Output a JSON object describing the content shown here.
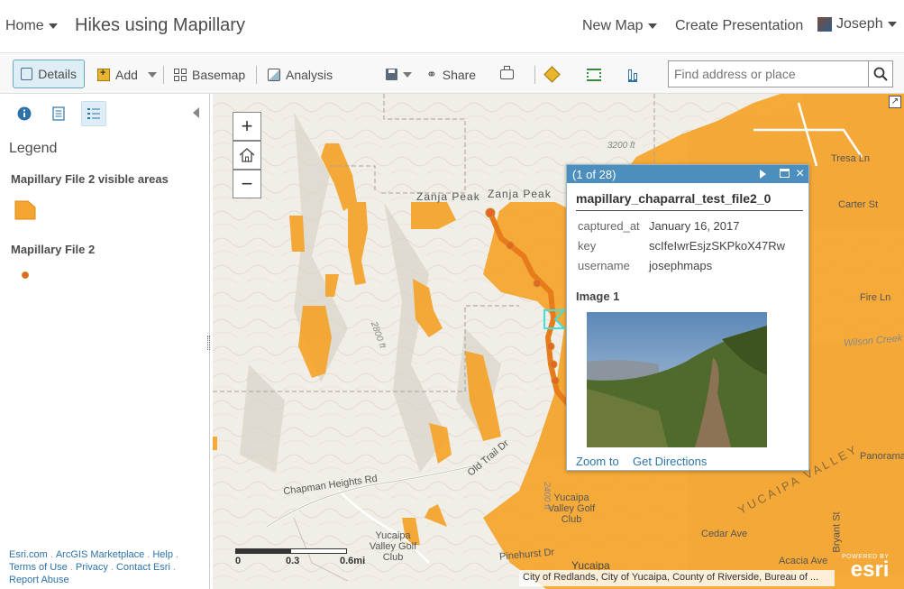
{
  "header": {
    "home_label": "Home",
    "title": "Hikes using Mapillary",
    "new_map_label": "New Map",
    "create_presentation_label": "Create Presentation",
    "user_name": "Joseph"
  },
  "toolbar": {
    "details_label": "Details",
    "add_label": "Add",
    "basemap_label": "Basemap",
    "analysis_label": "Analysis",
    "share_label": "Share",
    "search_placeholder": "Find address or place"
  },
  "sidebar": {
    "legend_title": "Legend",
    "layers": [
      {
        "title": "Mapillary File 2 visible areas"
      },
      {
        "title": "Mapillary File 2"
      }
    ],
    "footer_links": [
      "Esri.com",
      "ArcGIS Marketplace",
      "Help",
      "Terms of Use",
      "Privacy",
      "Contact Esri",
      "Report Abuse"
    ]
  },
  "map": {
    "labels": [
      "Zanja Peak",
      "Zanja Peak",
      "Tresa Ln",
      "Carter St",
      "Fire Ln",
      "Wilson Creek",
      "Chapman Heights Rd",
      "Old Trail Dr",
      "Yucaipa Valley Golf Club",
      "Yucaipa Valley Golf Club",
      "YUCAIPA VALLEY",
      "Cedar Ave",
      "Pinehurst Dr",
      "Yucaipa",
      "Acacia Ave",
      "Panorama",
      "Bryant St",
      "3200 ft",
      "2800 ft",
      "2400 ft"
    ],
    "scale_labels": [
      "0",
      "0.3",
      "0.6mi"
    ],
    "attribution": "City of Redlands, City of Yucaipa, County of Riverside, Bureau of ...",
    "esri_powered": "POWERED BY",
    "esri_logo": "esri"
  },
  "popup": {
    "counter": "(1 of 28)",
    "title": "mapillary_chaparral_test_file2_0",
    "fields": [
      {
        "key": "captured_at",
        "value": "January 16, 2017"
      },
      {
        "key": "key",
        "value": "scIfeIwrEsjzSKPkoX47Rw"
      },
      {
        "key": "username",
        "value": "josephmaps"
      }
    ],
    "image_label": "Image 1",
    "zoom_to_label": "Zoom to",
    "directions_label": "Get Directions"
  },
  "colors": {
    "accent": "#4c8ebd",
    "visible_area": "#f4a52f",
    "trail": "#e87b1c"
  }
}
